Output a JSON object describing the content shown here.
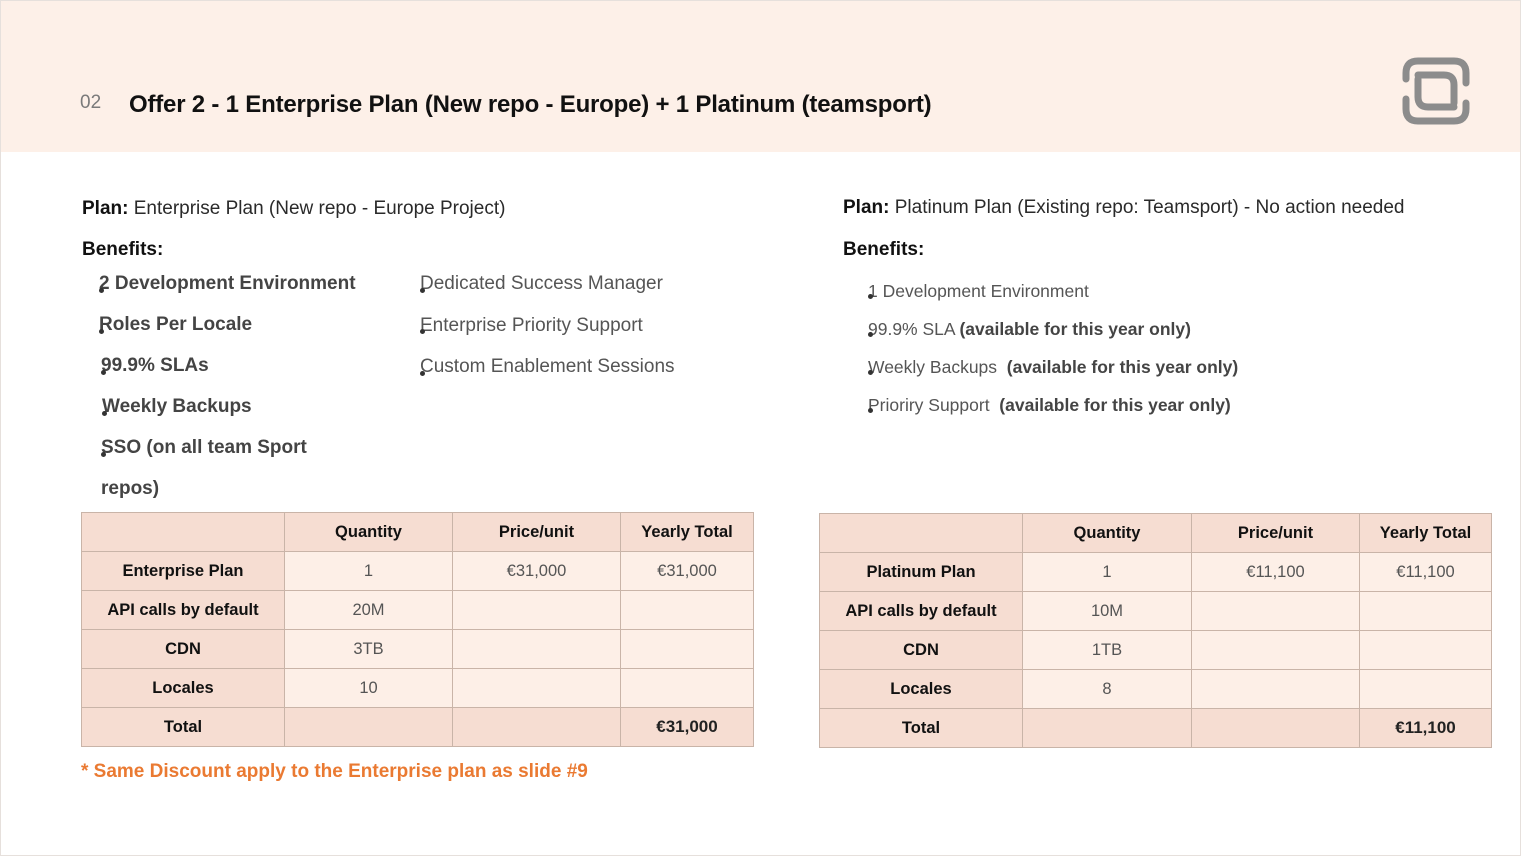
{
  "header": {
    "slide_number": "02",
    "title": "Offer 2 - 1 Enterprise Plan (New repo - Europe) + 1 Platinum (teamsport)"
  },
  "left": {
    "plan_label": "Plan:",
    "plan_value": " Enterprise Plan (New repo - Europe Project)",
    "benefits_label": "Benefits:",
    "benefits_col1": [
      "2 Development Environment",
      "Roles Per Locale",
      "99.9% SLAs",
      "Weekly Backups",
      "SSO (on all team Sport",
      "repos)"
    ],
    "benefits_col2": [
      "Dedicated Success Manager",
      "Enterprise Priority Support",
      "Custom Enablement Sessions"
    ],
    "table": {
      "headers": [
        "",
        "Quantity",
        "Price/unit",
        "Yearly Total"
      ],
      "rows": [
        [
          "Enterprise Plan",
          "1",
          "€31,000",
          "€31,000"
        ],
        [
          "API calls by default",
          "20M",
          "",
          ""
        ],
        [
          "CDN",
          "3TB",
          "",
          ""
        ],
        [
          "Locales",
          "10",
          "",
          ""
        ]
      ],
      "total_label": "Total",
      "total_value": "€31,000"
    }
  },
  "right": {
    "plan_label": "Plan:",
    "plan_value": " Platinum Plan (Existing repo: Teamsport) - No action needed",
    "benefits_label": "Benefits:",
    "benefits": [
      {
        "text": "1 Development Environment",
        "bold": ""
      },
      {
        "text": "99.9% SLA ",
        "bold": "(available for this year only)"
      },
      {
        "text": "Weekly Backups  ",
        "bold": "(available for this year only)"
      },
      {
        "text": "Prioriry Support  ",
        "bold": "(available for this year only)"
      }
    ],
    "table": {
      "headers": [
        "",
        "Quantity",
        "Price/unit",
        "Yearly Total"
      ],
      "rows": [
        [
          "Platinum Plan",
          "1",
          "€11,100",
          "€11,100"
        ],
        [
          "API calls by default",
          "10M",
          "",
          ""
        ],
        [
          "CDN",
          "1TB",
          "",
          ""
        ],
        [
          "Locales",
          "8",
          "",
          ""
        ]
      ],
      "total_label": "Total",
      "total_value": "€11,100"
    }
  },
  "footnote": "* Same Discount apply to the Enterprise plan as slide #9",
  "colors": {
    "header_bg": "#fdf0e8",
    "table_label_bg": "#f6ddd2",
    "table_cell_bg": "#fdefe7",
    "footnote": "#ea7a32",
    "logo": "#8c8c8c"
  }
}
